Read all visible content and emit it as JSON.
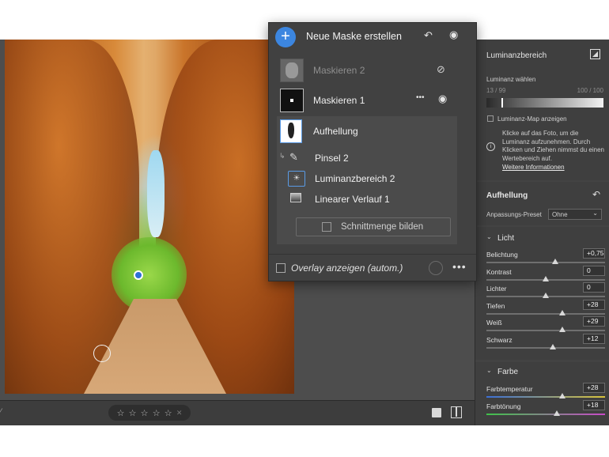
{
  "mask_panel": {
    "title": "Neue Maske erstellen",
    "add_symbol": "+",
    "masks": [
      {
        "label": "Maskieren 2",
        "hidden": true
      },
      {
        "label": "Maskieren 1",
        "hidden": false
      }
    ],
    "more_symbol": "•••",
    "adjustment_label": "Aufhellung",
    "components": [
      {
        "label": "Pinsel 2",
        "icon": "brush-icon"
      },
      {
        "label": "Luminanzbereich 2",
        "icon": "luminance-range-icon"
      },
      {
        "label": "Linearer Verlauf 1",
        "icon": "linear-gradient-icon"
      }
    ],
    "intersect_label": "Schnittmenge bilden",
    "overlay_label": "Overlay anzeigen (autom.)"
  },
  "right_panel": {
    "luminance": {
      "title": "Luminanzbereich",
      "choose_label": "Luminanz wählen",
      "range_left": "13 / 99",
      "range_right": "100 / 100",
      "map_label": "Luminanz-Map anzeigen",
      "info_text": "Klicke auf das Foto, um die Luminanz aufzunehmen. Durch Klicken und Ziehen nimmst du einen Wertebereich auf.",
      "info_link": "Weitere Informationen"
    },
    "adjust": {
      "title": "Aufhellung",
      "preset_label": "Anpassungs-Preset",
      "preset_value": "Ohne"
    },
    "light": {
      "title": "Licht",
      "sliders": [
        {
          "label": "Belichtung",
          "value": "+0,75",
          "pos": 0.58
        },
        {
          "label": "Kontrast",
          "value": "0",
          "pos": 0.5
        },
        {
          "label": "Lichter",
          "value": "0",
          "pos": 0.5
        },
        {
          "label": "Tiefen",
          "value": "+28",
          "pos": 0.64
        },
        {
          "label": "Weiß",
          "value": "+29",
          "pos": 0.64
        },
        {
          "label": "Schwarz",
          "value": "+12",
          "pos": 0.56
        }
      ]
    },
    "color": {
      "title": "Farbe",
      "sliders": [
        {
          "label": "Farbtemperatur",
          "value": "+28",
          "pos": 0.64
        },
        {
          "label": "Farbtönung",
          "value": "+18",
          "pos": 0.59
        }
      ]
    }
  },
  "bottom_bar": {
    "stars": [
      "☆",
      "☆",
      "☆",
      "☆",
      "☆"
    ],
    "trash": "🗑"
  },
  "colors": {
    "accent": "#3c86e0",
    "panel_bg": "#414141"
  }
}
